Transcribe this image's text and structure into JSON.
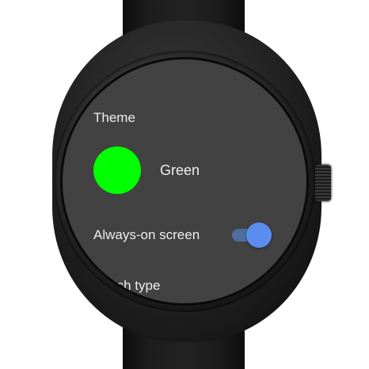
{
  "settings": {
    "theme_label": "Theme",
    "theme_color_name": "Green",
    "theme_color_hex": "#00ff00",
    "aod_label": "Always-on screen",
    "aod_enabled": true,
    "watch_type_label": "Watch type"
  },
  "colors": {
    "screen_background": "#424242",
    "text": "#eeeeee",
    "toggle_thumb": "#5b8def",
    "toggle_track": "#4f6d9e"
  }
}
